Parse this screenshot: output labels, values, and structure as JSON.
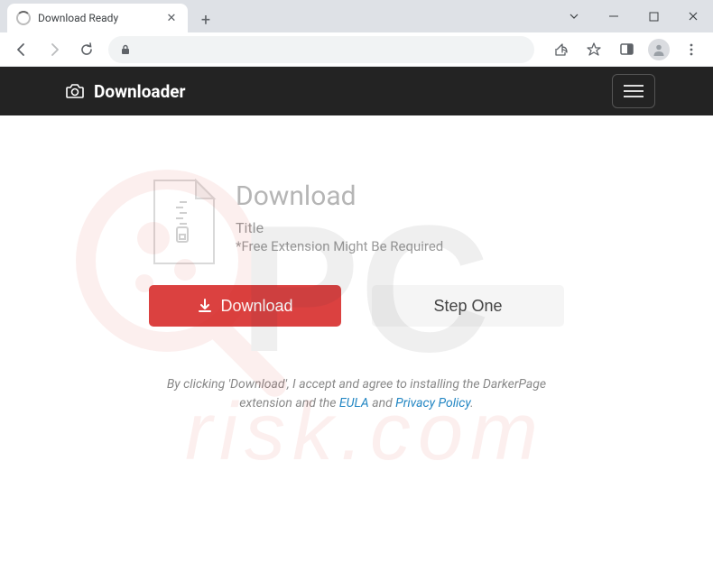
{
  "browser": {
    "tab_title": "Download Ready"
  },
  "navbar": {
    "brand": "Downloader"
  },
  "card": {
    "heading": "Download",
    "subtitle": "Title",
    "note": "*Free Extension Might Be Required"
  },
  "buttons": {
    "download": "Download",
    "step_one": "Step One"
  },
  "disclaimer": {
    "part1": "By clicking 'Download', I accept and agree to installing the DarkerPage extension and the ",
    "link1": "EULA",
    "part2": " and ",
    "link2": "Privacy Policy",
    "part3": "."
  }
}
